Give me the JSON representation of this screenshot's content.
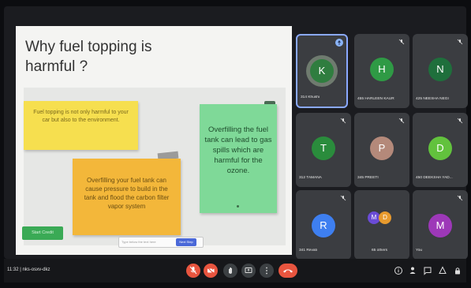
{
  "slide": {
    "title": "Why fuel topping is harmful ?",
    "note1": "Fuel topping is not only harmful to your car but also to the environment.",
    "note2": "Overfilling your fuel tank can cause pressure to build in the tank and flood the carbon filter vapor system",
    "note3": "Overfilling the fuel tank can lead to gas spills which are harmful for the ozone.",
    "chip_label": "Start Credit",
    "entry_text": "Type below the text here",
    "entry_button": "Next Step"
  },
  "participants": [
    {
      "initial": "K",
      "name": "314 Khushi",
      "color": "#2f7d3f",
      "ring": "#6f7b6f",
      "active": true
    },
    {
      "initial": "H",
      "name": "455 HARLEEN KAUR",
      "color": "#2f9a45"
    },
    {
      "initial": "N",
      "name": "425 NEESHA NEGI",
      "color": "#1f6f3c"
    },
    {
      "initial": "T",
      "name": "312 TAMANA",
      "color": "#2a8c3c"
    },
    {
      "initial": "P",
      "name": "345 PREETI",
      "color": "#b4897a"
    },
    {
      "initial": "D",
      "name": "450 DEEKSHA YAD...",
      "color": "#62c23d"
    },
    {
      "initial": "R",
      "name": "341 Revati",
      "color": "#3e7ff0"
    },
    {
      "initial": "",
      "name": "65 others",
      "others": true
    },
    {
      "initial": "M",
      "name": "You",
      "color": "#9d38b8"
    }
  ],
  "others_avatars": [
    {
      "initial": "M",
      "color": "#6a4bd6"
    },
    {
      "initial": "D",
      "color": "#e79a2e"
    }
  ],
  "bottom_bar": {
    "meeting_info": "11:32 | nks-osxv-dkz"
  },
  "icons": {
    "mic": "mic-off-icon",
    "camera": "camera-off-icon",
    "hand": "raise-hand-icon",
    "present": "present-screen-icon",
    "more": "more-options-icon",
    "hangup": "hang-up-icon",
    "info": "info-icon",
    "people": "people-icon",
    "chat": "chat-icon",
    "activities": "activities-icon",
    "lock": "host-controls-icon"
  },
  "colors": {
    "control_red": "#e8553f",
    "control_grey": "#3c4043",
    "tile_bg": "#3b3d41",
    "accent_blue": "#8ab4f8"
  }
}
